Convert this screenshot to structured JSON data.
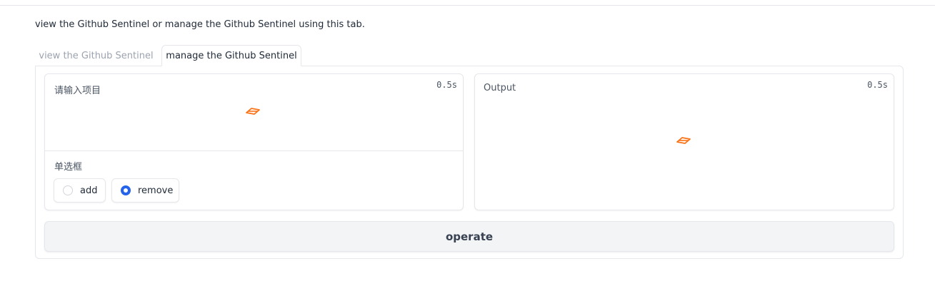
{
  "description": "view the Github Sentinel or manage the Github Sentinel using this tab.",
  "tabs": [
    {
      "label": "view the Github Sentinel",
      "active": false
    },
    {
      "label": "manage the Github Sentinel",
      "active": true
    }
  ],
  "input_block": {
    "label": "请输入项目",
    "timer": "0.5s",
    "loading_icon": "loader-icon"
  },
  "radio_block": {
    "label": "单选框",
    "options": [
      {
        "label": "add",
        "checked": false
      },
      {
        "label": "remove",
        "checked": true
      }
    ],
    "accent_color": "#2563eb"
  },
  "output_block": {
    "label": "Output",
    "timer": "0.5s",
    "loading_icon": "loader-icon"
  },
  "operate_button": {
    "label": "operate"
  },
  "colors": {
    "loader": "#f97316",
    "border": "#e5e7eb",
    "button_bg": "#f3f4f6"
  }
}
